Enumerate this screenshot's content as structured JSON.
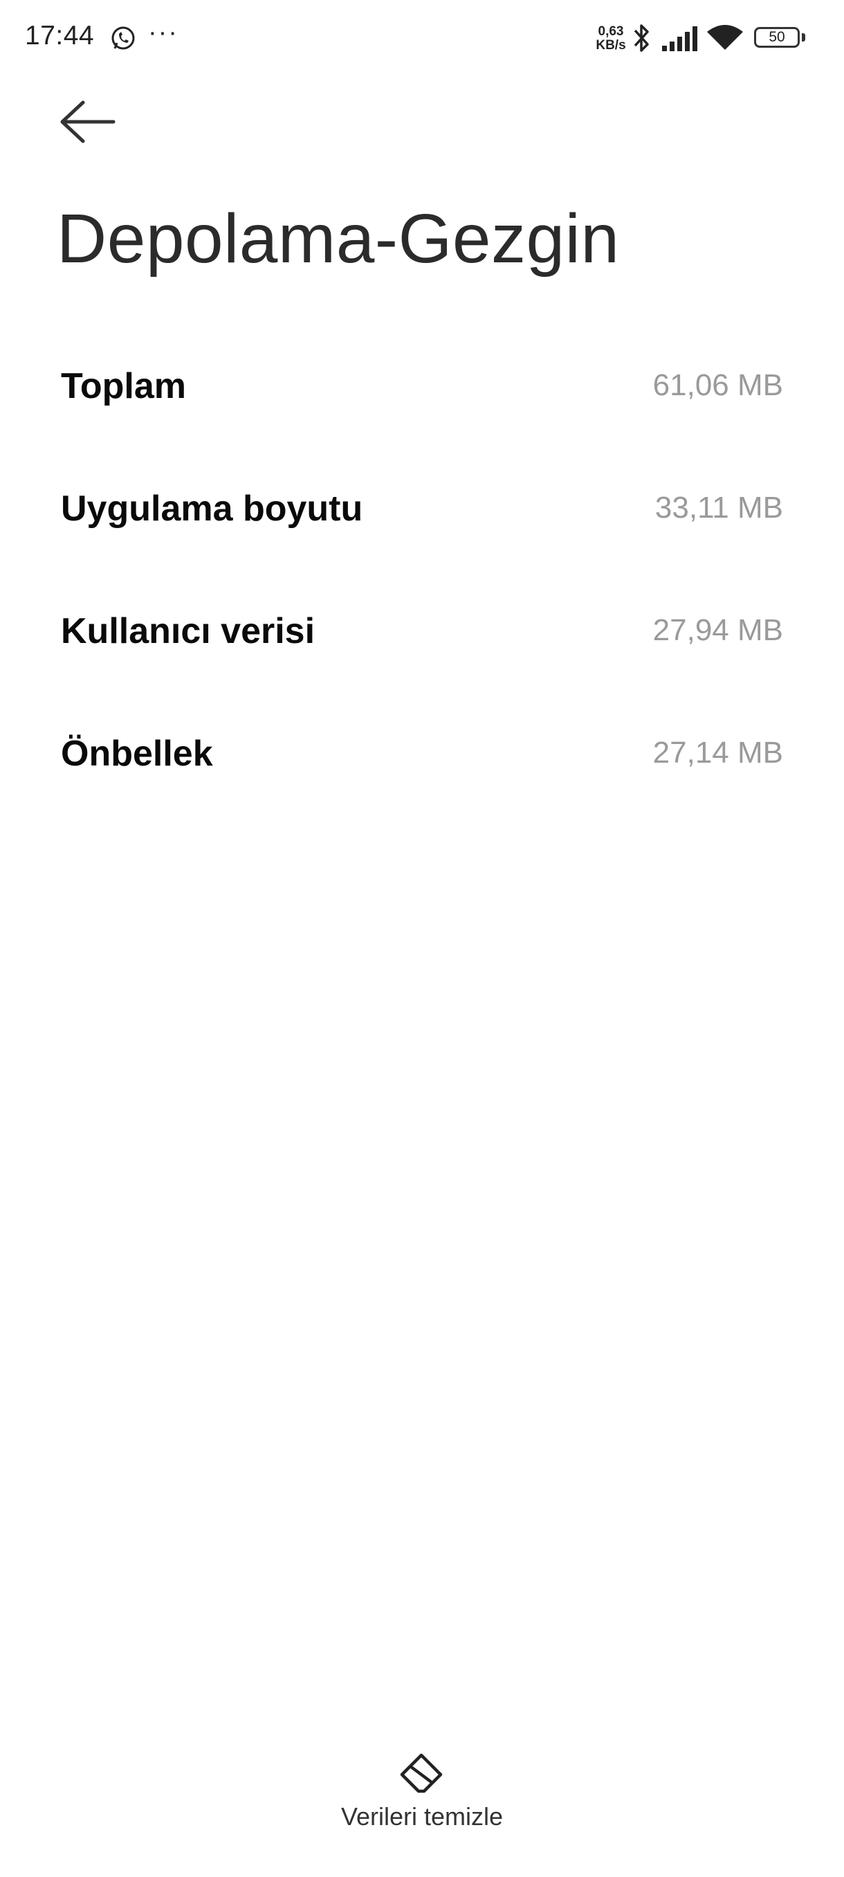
{
  "status_bar": {
    "time": "17:44",
    "net_speed_value": "0,63",
    "net_speed_unit": "KB/s",
    "battery": "50",
    "icons": [
      "whatsapp-icon",
      "more-dots-icon",
      "bluetooth-icon",
      "signal-icon",
      "wifi-icon",
      "battery-icon"
    ]
  },
  "header": {
    "back_icon": "arrow-left-icon",
    "title": "Depolama-Gezgin"
  },
  "storage": {
    "rows": [
      {
        "label": "Toplam",
        "value": "61,06 MB"
      },
      {
        "label": "Uygulama boyutu",
        "value": "33,11 MB"
      },
      {
        "label": "Kullanıcı verisi",
        "value": "27,94 MB"
      },
      {
        "label": "Önbellek",
        "value": "27,14 MB"
      }
    ]
  },
  "footer": {
    "clear_icon": "eraser-icon",
    "clear_label": "Verileri temizle"
  }
}
